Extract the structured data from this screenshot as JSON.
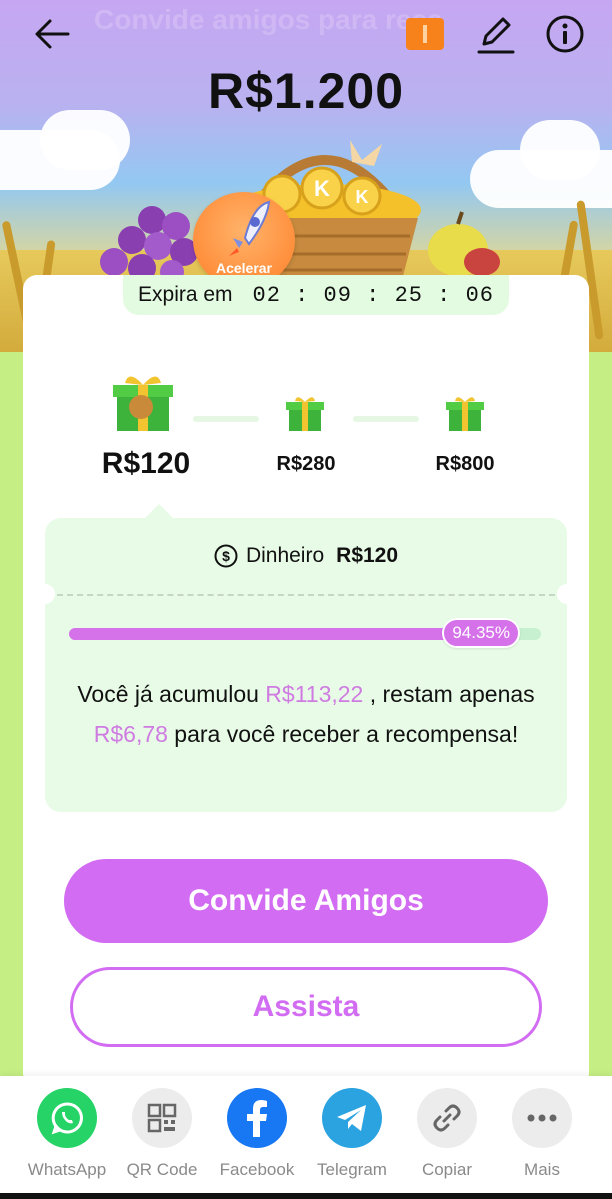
{
  "header": {
    "faint_title": "Convide amigos para rece",
    "amount": "R$1.200",
    "icons": [
      "back-arrow-icon",
      "ticket-icon",
      "edit-icon",
      "info-icon"
    ]
  },
  "rocket": {
    "label": "Acelerar"
  },
  "expire": {
    "label": "Expira em",
    "timer": "02 : 09 : 25 : 06"
  },
  "milestones": [
    {
      "value": "R$120",
      "active": true
    },
    {
      "value": "R$280",
      "active": false
    },
    {
      "value": "R$800",
      "active": false
    }
  ],
  "reward": {
    "money_label": "Dinheiro",
    "money_value": "R$120",
    "progress_percent": 94.35,
    "progress_label": "94.35%",
    "msg_part1": "Você já acumulou ",
    "msg_accumulated": "R$113,22",
    "msg_part2": " , restam apenas ",
    "msg_remaining": "R$6,78",
    "msg_part3": " para você receber a recompensa!"
  },
  "buttons": {
    "invite": "Convide Amigos",
    "watch": "Assista"
  },
  "share": [
    {
      "label": "WhatsApp",
      "icon": "whatsapp-icon",
      "color": "#25d366"
    },
    {
      "label": "QR Code",
      "icon": "qr-code-icon",
      "color": "#ececec"
    },
    {
      "label": "Facebook",
      "icon": "facebook-icon",
      "color": "#1877f2"
    },
    {
      "label": "Telegram",
      "icon": "telegram-icon",
      "color": "#2aa3e0"
    },
    {
      "label": "Copiar",
      "icon": "link-icon",
      "color": "#ececec"
    },
    {
      "label": "Mais",
      "icon": "more-icon",
      "color": "#ececec"
    }
  ],
  "colors": {
    "accent": "#d26cf2",
    "highlight": "#cf7be2",
    "panel": "#e7fbe6",
    "page_bg": "#c5ee84"
  }
}
